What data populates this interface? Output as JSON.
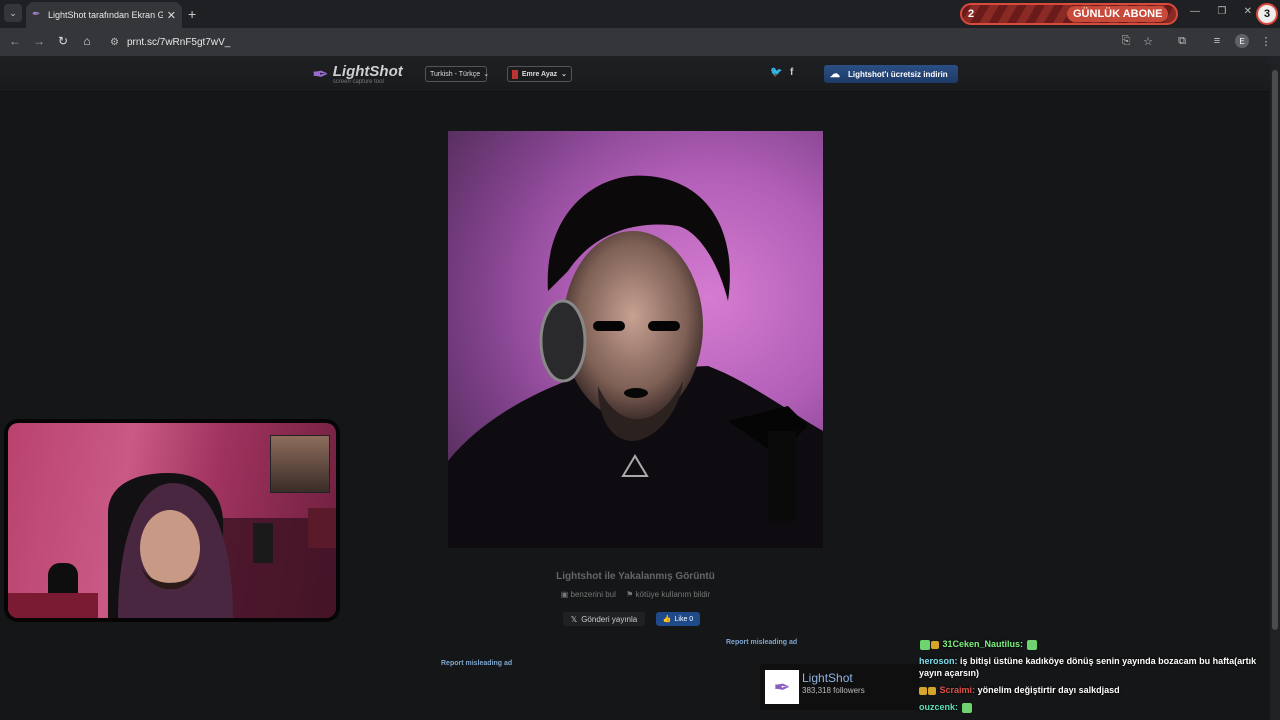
{
  "browser": {
    "tab_list_icon": "chevron-down-icon",
    "tab_title": "LightShot tarafından Ekran Görüntüsü",
    "new_tab_icon": "plus-icon",
    "url": "prnt.sc/7wRnF5gt7wV_",
    "window_controls": [
      "—",
      "❐",
      "✕"
    ]
  },
  "stream_overlay": {
    "sub_current": "2",
    "sub_label": "GÜNLÜK ABONE",
    "sub_goal": "3"
  },
  "site": {
    "logo_name": "LightShot",
    "logo_tagline": "screen capture tool",
    "language": "Turkish - Türkçe",
    "user": "Emre Ayaz",
    "download_label": "Lightshot'ı ücretsiz indirin",
    "caption": "Lightshot ile Yakalanmış Görüntü",
    "find_similar": "benzerini bul",
    "report_abuse": "kötüye kullanım bildir",
    "tweet_label": "Gönderi yayınla",
    "like_label": "Like 0",
    "report_ad_1": "Report misleading ad",
    "report_ad_2": "Report misleading ad",
    "widget_name": "LightShot",
    "widget_followers": "383,318 followers"
  },
  "chat": [
    {
      "user": "31Ceken_Nautilus:",
      "message": "",
      "color": "green"
    },
    {
      "user": "heroson:",
      "message": "iş bitişi üstüne kadıköye dönüş senin yayında bozacam bu hafta(artık yayın açarsın)",
      "color": "cyan"
    },
    {
      "user": "Scraimi:",
      "message": "yönelim değiştirtir dayı salkdjasd",
      "color": "red"
    },
    {
      "user": "ouzcenk:",
      "message": "",
      "color": "teal"
    }
  ]
}
